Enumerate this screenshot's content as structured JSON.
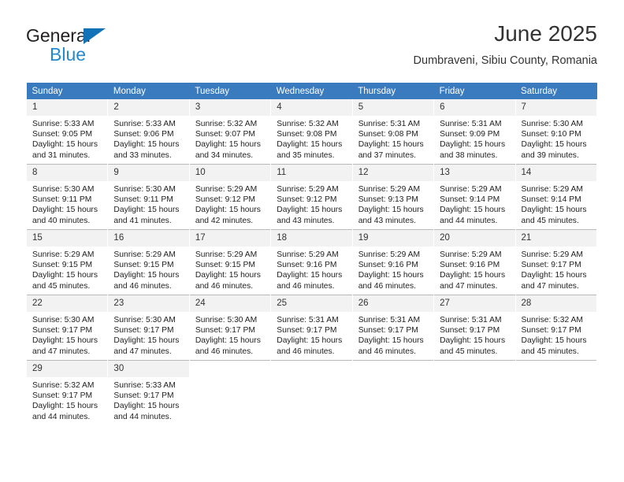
{
  "brand": {
    "name_part1": "General",
    "name_part2": "Blue",
    "logo_icon": "triangle-flag-icon"
  },
  "header": {
    "title": "June 2025",
    "subtitle": "Dumbraveni, Sibiu County, Romania"
  },
  "colors": {
    "header_blue": "#3a7bbf",
    "brand_blue": "#2389cf",
    "daynum_band": "#f2f2f2",
    "grid_line": "#b9b9b9",
    "text": "#333333"
  },
  "weekdays": [
    "Sunday",
    "Monday",
    "Tuesday",
    "Wednesday",
    "Thursday",
    "Friday",
    "Saturday"
  ],
  "labels": {
    "sunrise_prefix": "Sunrise:",
    "sunset_prefix": "Sunset:",
    "daylight_prefix": "Daylight:"
  },
  "weeks": [
    [
      {
        "day": "1",
        "sunrise": "Sunrise: 5:33 AM",
        "sunset": "Sunset: 9:05 PM",
        "daylight_line1": "Daylight: 15 hours",
        "daylight_line2": "and 31 minutes."
      },
      {
        "day": "2",
        "sunrise": "Sunrise: 5:33 AM",
        "sunset": "Sunset: 9:06 PM",
        "daylight_line1": "Daylight: 15 hours",
        "daylight_line2": "and 33 minutes."
      },
      {
        "day": "3",
        "sunrise": "Sunrise: 5:32 AM",
        "sunset": "Sunset: 9:07 PM",
        "daylight_line1": "Daylight: 15 hours",
        "daylight_line2": "and 34 minutes."
      },
      {
        "day": "4",
        "sunrise": "Sunrise: 5:32 AM",
        "sunset": "Sunset: 9:08 PM",
        "daylight_line1": "Daylight: 15 hours",
        "daylight_line2": "and 35 minutes."
      },
      {
        "day": "5",
        "sunrise": "Sunrise: 5:31 AM",
        "sunset": "Sunset: 9:08 PM",
        "daylight_line1": "Daylight: 15 hours",
        "daylight_line2": "and 37 minutes."
      },
      {
        "day": "6",
        "sunrise": "Sunrise: 5:31 AM",
        "sunset": "Sunset: 9:09 PM",
        "daylight_line1": "Daylight: 15 hours",
        "daylight_line2": "and 38 minutes."
      },
      {
        "day": "7",
        "sunrise": "Sunrise: 5:30 AM",
        "sunset": "Sunset: 9:10 PM",
        "daylight_line1": "Daylight: 15 hours",
        "daylight_line2": "and 39 minutes."
      }
    ],
    [
      {
        "day": "8",
        "sunrise": "Sunrise: 5:30 AM",
        "sunset": "Sunset: 9:11 PM",
        "daylight_line1": "Daylight: 15 hours",
        "daylight_line2": "and 40 minutes."
      },
      {
        "day": "9",
        "sunrise": "Sunrise: 5:30 AM",
        "sunset": "Sunset: 9:11 PM",
        "daylight_line1": "Daylight: 15 hours",
        "daylight_line2": "and 41 minutes."
      },
      {
        "day": "10",
        "sunrise": "Sunrise: 5:29 AM",
        "sunset": "Sunset: 9:12 PM",
        "daylight_line1": "Daylight: 15 hours",
        "daylight_line2": "and 42 minutes."
      },
      {
        "day": "11",
        "sunrise": "Sunrise: 5:29 AM",
        "sunset": "Sunset: 9:12 PM",
        "daylight_line1": "Daylight: 15 hours",
        "daylight_line2": "and 43 minutes."
      },
      {
        "day": "12",
        "sunrise": "Sunrise: 5:29 AM",
        "sunset": "Sunset: 9:13 PM",
        "daylight_line1": "Daylight: 15 hours",
        "daylight_line2": "and 43 minutes."
      },
      {
        "day": "13",
        "sunrise": "Sunrise: 5:29 AM",
        "sunset": "Sunset: 9:14 PM",
        "daylight_line1": "Daylight: 15 hours",
        "daylight_line2": "and 44 minutes."
      },
      {
        "day": "14",
        "sunrise": "Sunrise: 5:29 AM",
        "sunset": "Sunset: 9:14 PM",
        "daylight_line1": "Daylight: 15 hours",
        "daylight_line2": "and 45 minutes."
      }
    ],
    [
      {
        "day": "15",
        "sunrise": "Sunrise: 5:29 AM",
        "sunset": "Sunset: 9:15 PM",
        "daylight_line1": "Daylight: 15 hours",
        "daylight_line2": "and 45 minutes."
      },
      {
        "day": "16",
        "sunrise": "Sunrise: 5:29 AM",
        "sunset": "Sunset: 9:15 PM",
        "daylight_line1": "Daylight: 15 hours",
        "daylight_line2": "and 46 minutes."
      },
      {
        "day": "17",
        "sunrise": "Sunrise: 5:29 AM",
        "sunset": "Sunset: 9:15 PM",
        "daylight_line1": "Daylight: 15 hours",
        "daylight_line2": "and 46 minutes."
      },
      {
        "day": "18",
        "sunrise": "Sunrise: 5:29 AM",
        "sunset": "Sunset: 9:16 PM",
        "daylight_line1": "Daylight: 15 hours",
        "daylight_line2": "and 46 minutes."
      },
      {
        "day": "19",
        "sunrise": "Sunrise: 5:29 AM",
        "sunset": "Sunset: 9:16 PM",
        "daylight_line1": "Daylight: 15 hours",
        "daylight_line2": "and 46 minutes."
      },
      {
        "day": "20",
        "sunrise": "Sunrise: 5:29 AM",
        "sunset": "Sunset: 9:16 PM",
        "daylight_line1": "Daylight: 15 hours",
        "daylight_line2": "and 47 minutes."
      },
      {
        "day": "21",
        "sunrise": "Sunrise: 5:29 AM",
        "sunset": "Sunset: 9:17 PM",
        "daylight_line1": "Daylight: 15 hours",
        "daylight_line2": "and 47 minutes."
      }
    ],
    [
      {
        "day": "22",
        "sunrise": "Sunrise: 5:30 AM",
        "sunset": "Sunset: 9:17 PM",
        "daylight_line1": "Daylight: 15 hours",
        "daylight_line2": "and 47 minutes."
      },
      {
        "day": "23",
        "sunrise": "Sunrise: 5:30 AM",
        "sunset": "Sunset: 9:17 PM",
        "daylight_line1": "Daylight: 15 hours",
        "daylight_line2": "and 47 minutes."
      },
      {
        "day": "24",
        "sunrise": "Sunrise: 5:30 AM",
        "sunset": "Sunset: 9:17 PM",
        "daylight_line1": "Daylight: 15 hours",
        "daylight_line2": "and 46 minutes."
      },
      {
        "day": "25",
        "sunrise": "Sunrise: 5:31 AM",
        "sunset": "Sunset: 9:17 PM",
        "daylight_line1": "Daylight: 15 hours",
        "daylight_line2": "and 46 minutes."
      },
      {
        "day": "26",
        "sunrise": "Sunrise: 5:31 AM",
        "sunset": "Sunset: 9:17 PM",
        "daylight_line1": "Daylight: 15 hours",
        "daylight_line2": "and 46 minutes."
      },
      {
        "day": "27",
        "sunrise": "Sunrise: 5:31 AM",
        "sunset": "Sunset: 9:17 PM",
        "daylight_line1": "Daylight: 15 hours",
        "daylight_line2": "and 45 minutes."
      },
      {
        "day": "28",
        "sunrise": "Sunrise: 5:32 AM",
        "sunset": "Sunset: 9:17 PM",
        "daylight_line1": "Daylight: 15 hours",
        "daylight_line2": "and 45 minutes."
      }
    ],
    [
      {
        "day": "29",
        "sunrise": "Sunrise: 5:32 AM",
        "sunset": "Sunset: 9:17 PM",
        "daylight_line1": "Daylight: 15 hours",
        "daylight_line2": "and 44 minutes."
      },
      {
        "day": "30",
        "sunrise": "Sunrise: 5:33 AM",
        "sunset": "Sunset: 9:17 PM",
        "daylight_line1": "Daylight: 15 hours",
        "daylight_line2": "and 44 minutes."
      },
      {
        "day": "",
        "sunrise": "",
        "sunset": "",
        "daylight_line1": "",
        "daylight_line2": ""
      },
      {
        "day": "",
        "sunrise": "",
        "sunset": "",
        "daylight_line1": "",
        "daylight_line2": ""
      },
      {
        "day": "",
        "sunrise": "",
        "sunset": "",
        "daylight_line1": "",
        "daylight_line2": ""
      },
      {
        "day": "",
        "sunrise": "",
        "sunset": "",
        "daylight_line1": "",
        "daylight_line2": ""
      },
      {
        "day": "",
        "sunrise": "",
        "sunset": "",
        "daylight_line1": "",
        "daylight_line2": ""
      }
    ]
  ]
}
